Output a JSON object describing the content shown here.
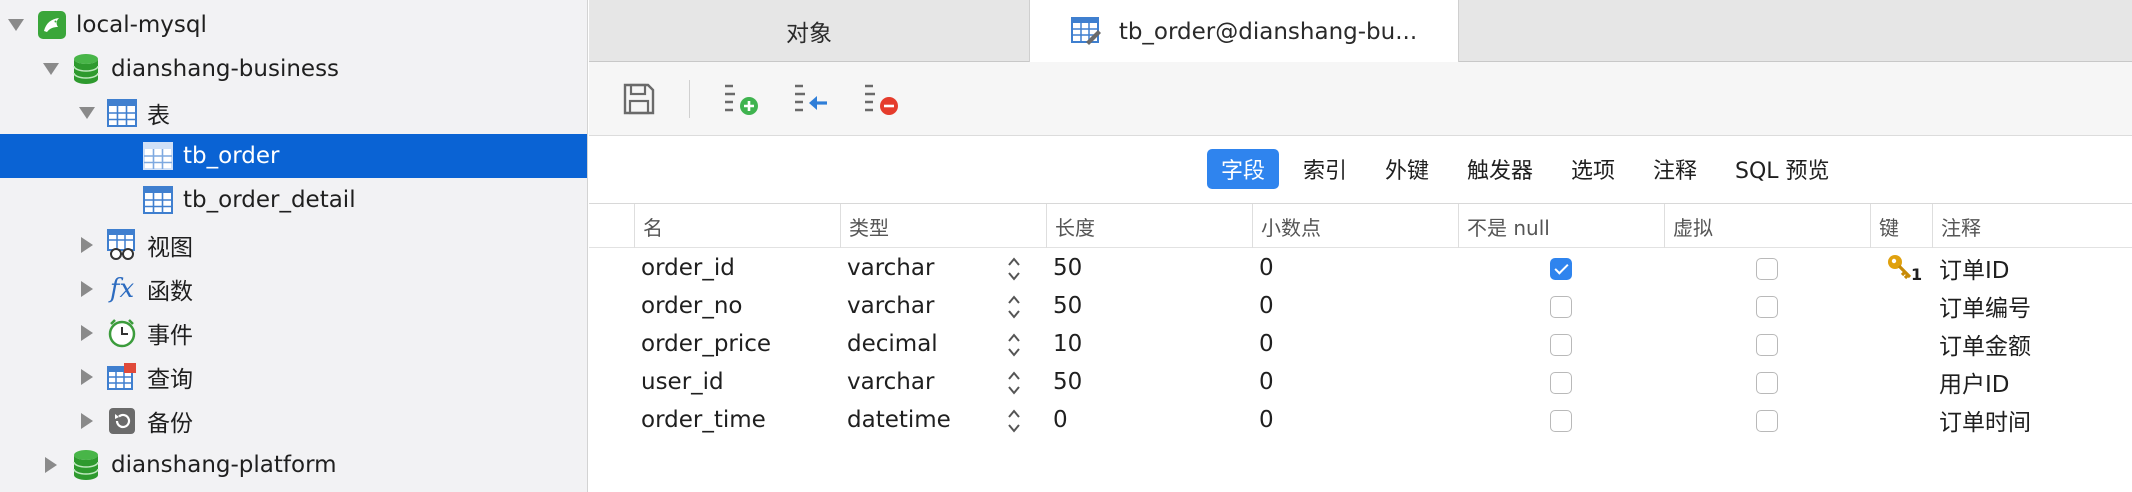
{
  "sidebar": {
    "connection": {
      "label": "local-mysql",
      "icon": "mysql-dolphin-icon"
    },
    "database": {
      "label": "dianshang-business",
      "icon": "database-icon"
    },
    "tables_group": {
      "label": "表",
      "icon": "table-icon"
    },
    "tables": [
      {
        "label": "tb_order",
        "selected": true
      },
      {
        "label": "tb_order_detail",
        "selected": false
      }
    ],
    "groups": [
      {
        "label": "视图",
        "icon": "view-icon"
      },
      {
        "label": "函数",
        "icon": "function-icon"
      },
      {
        "label": "事件",
        "icon": "event-clock-icon"
      },
      {
        "label": "查询",
        "icon": "query-icon"
      },
      {
        "label": "备份",
        "icon": "backup-icon"
      }
    ],
    "other_database": {
      "label": "dianshang-platform",
      "icon": "database-icon"
    }
  },
  "tabs": [
    {
      "label": "对象",
      "active": false
    },
    {
      "label": "tb_order@dianshang-bu...",
      "active": true,
      "icon": "table-edit-icon"
    }
  ],
  "toolbar": {
    "buttons": [
      {
        "name": "save",
        "icon": "save-icon"
      },
      {
        "name": "add-field",
        "icon": "add-field-icon"
      },
      {
        "name": "insert-field",
        "icon": "insert-field-icon"
      },
      {
        "name": "delete-field",
        "icon": "delete-field-icon"
      }
    ]
  },
  "segments": [
    {
      "label": "字段",
      "active": true
    },
    {
      "label": "索引",
      "active": false
    },
    {
      "label": "外键",
      "active": false
    },
    {
      "label": "触发器",
      "active": false
    },
    {
      "label": "选项",
      "active": false
    },
    {
      "label": "注释",
      "active": false
    },
    {
      "label": "SQL 预览",
      "active": false
    }
  ],
  "grid": {
    "columns": [
      "名",
      "类型",
      "长度",
      "小数点",
      "不是 null",
      "虚拟",
      "键",
      "注释"
    ],
    "rows": [
      {
        "name": "order_id",
        "type": "varchar",
        "length": "50",
        "decimals": "0",
        "not_null": true,
        "virtual": false,
        "key": "1",
        "comment": "订单ID"
      },
      {
        "name": "order_no",
        "type": "varchar",
        "length": "50",
        "decimals": "0",
        "not_null": false,
        "virtual": false,
        "key": "",
        "comment": "订单编号"
      },
      {
        "name": "order_price",
        "type": "decimal",
        "length": "10",
        "decimals": "0",
        "not_null": false,
        "virtual": false,
        "key": "",
        "comment": "订单金额"
      },
      {
        "name": "user_id",
        "type": "varchar",
        "length": "50",
        "decimals": "0",
        "not_null": false,
        "virtual": false,
        "key": "",
        "comment": "用户ID"
      },
      {
        "name": "order_time",
        "type": "datetime",
        "length": "0",
        "decimals": "0",
        "not_null": false,
        "virtual": false,
        "key": "",
        "comment": "订单时间"
      }
    ]
  },
  "colors": {
    "selection": "#0a63d4",
    "accent": "#2f84ee",
    "db_green": "#3aa63a",
    "key_gold": "#e0a10e"
  }
}
